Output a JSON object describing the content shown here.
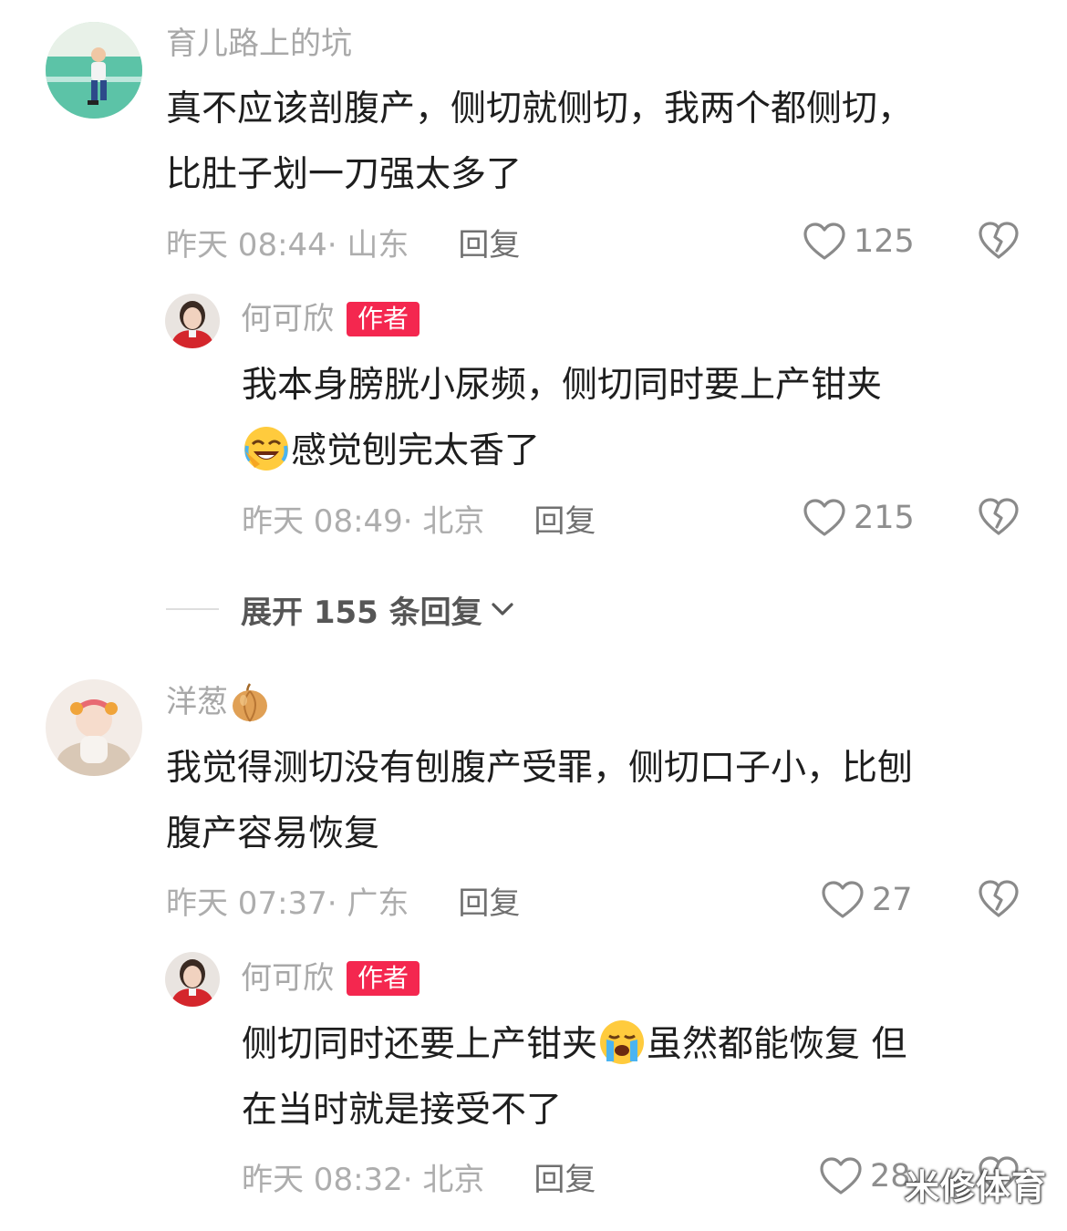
{
  "comments": [
    {
      "username": "育儿路上的坑",
      "avatar": "child-playing-on-court-photo",
      "lines": [
        "真不应该剖腹产，侧切就侧切，我两个都侧切，",
        "比肚子划一刀强太多了"
      ],
      "time": "昨天 08:44",
      "location": "· 山东",
      "reply_label": "回复",
      "likes": "125",
      "reply": {
        "username": "何可欣",
        "badge": "作者",
        "avatar": "woman-in-red-jacket-photo",
        "line1": "我本身膀胱小尿频，侧切同时要上产钳夹",
        "line2_emoji": "rofl-emoji",
        "line2": "感觉刨完太香了",
        "time": "昨天 08:49",
        "location": "· 北京",
        "reply_label": "回复",
        "likes": "215"
      }
    },
    {
      "username": "洋葱",
      "username_emoji": "onion-emoji",
      "avatar": "baby-with-headband-photo",
      "lines": [
        "我觉得测切没有刨腹产受罪，侧切口子小，比刨",
        "腹产容易恢复"
      ],
      "time": "昨天 07:37",
      "location": "· 广东",
      "reply_label": "回复",
      "likes": "27",
      "reply": {
        "username": "何可欣",
        "badge": "作者",
        "avatar": "woman-in-red-jacket-photo",
        "line1_a": "侧切同时还要上产钳夹",
        "line1_emoji": "crying-emoji",
        "line1_b": "虽然都能恢复 但",
        "line2": "在当时就是接受不了",
        "time": "昨天 08:32",
        "location": "· 北京",
        "reply_label": "回复",
        "likes": "28"
      }
    }
  ],
  "expand_replies": "展开 155 条回复",
  "watermark": "米修体育",
  "colors": {
    "author_badge": "#f4274f",
    "muted_text": "#a8a8a8",
    "body_text": "#1e1e1e"
  }
}
